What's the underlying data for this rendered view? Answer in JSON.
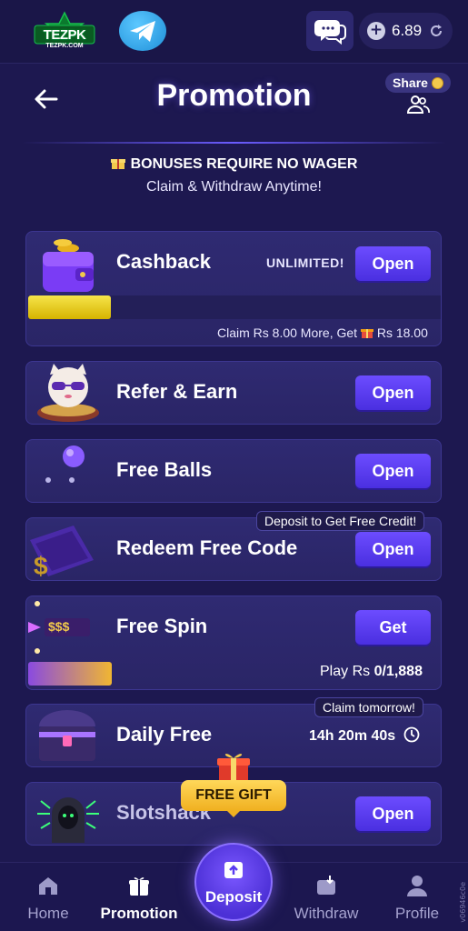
{
  "topbar": {
    "logo_text": "TEZPK",
    "logo_sub": "TEZPK.COM",
    "balance": "6.89"
  },
  "header": {
    "title": "Promotion",
    "share_label": "Share"
  },
  "notice": {
    "line1": "BONUSES REQUIRE NO WAGER",
    "line2": "Claim & Withdraw Anytime!"
  },
  "cards": {
    "cashback": {
      "title": "Cashback",
      "badge": "UNLIMITED!",
      "button": "Open",
      "progress": 0.2,
      "claim_prefix": "Claim Rs 8.00 More, Get",
      "claim_suffix": "Rs 18.00"
    },
    "refer": {
      "title": "Refer & Earn",
      "button": "Open"
    },
    "balls": {
      "title": "Free Balls",
      "button": "Open"
    },
    "redeem": {
      "title": "Redeem Free Code",
      "button": "Open",
      "tag": "Deposit to Get Free Credit!"
    },
    "spin": {
      "title": "Free Spin",
      "button": "Get",
      "sign_text": "$$$",
      "progress": 0.2,
      "play_prefix": "Play Rs",
      "play_value": "0/1,888"
    },
    "daily": {
      "title": "Daily Free",
      "timer": "14h 20m 40s",
      "tag": "Claim tomorrow!"
    },
    "slot": {
      "title": "Slotshack",
      "button": "Open"
    }
  },
  "free_gift_label": "FREE GIFT",
  "bottom_nav": {
    "home": "Home",
    "promotion": "Promotion",
    "deposit": "Deposit",
    "withdraw": "Withdraw",
    "profile": "Profile"
  },
  "side_mark": "v06946c0e",
  "colors": {
    "background": "#1d1850",
    "card": "#2f2a72",
    "button": "#5a3cf0",
    "gold": "#f2c94c",
    "progress_spin": "#f0b632"
  }
}
